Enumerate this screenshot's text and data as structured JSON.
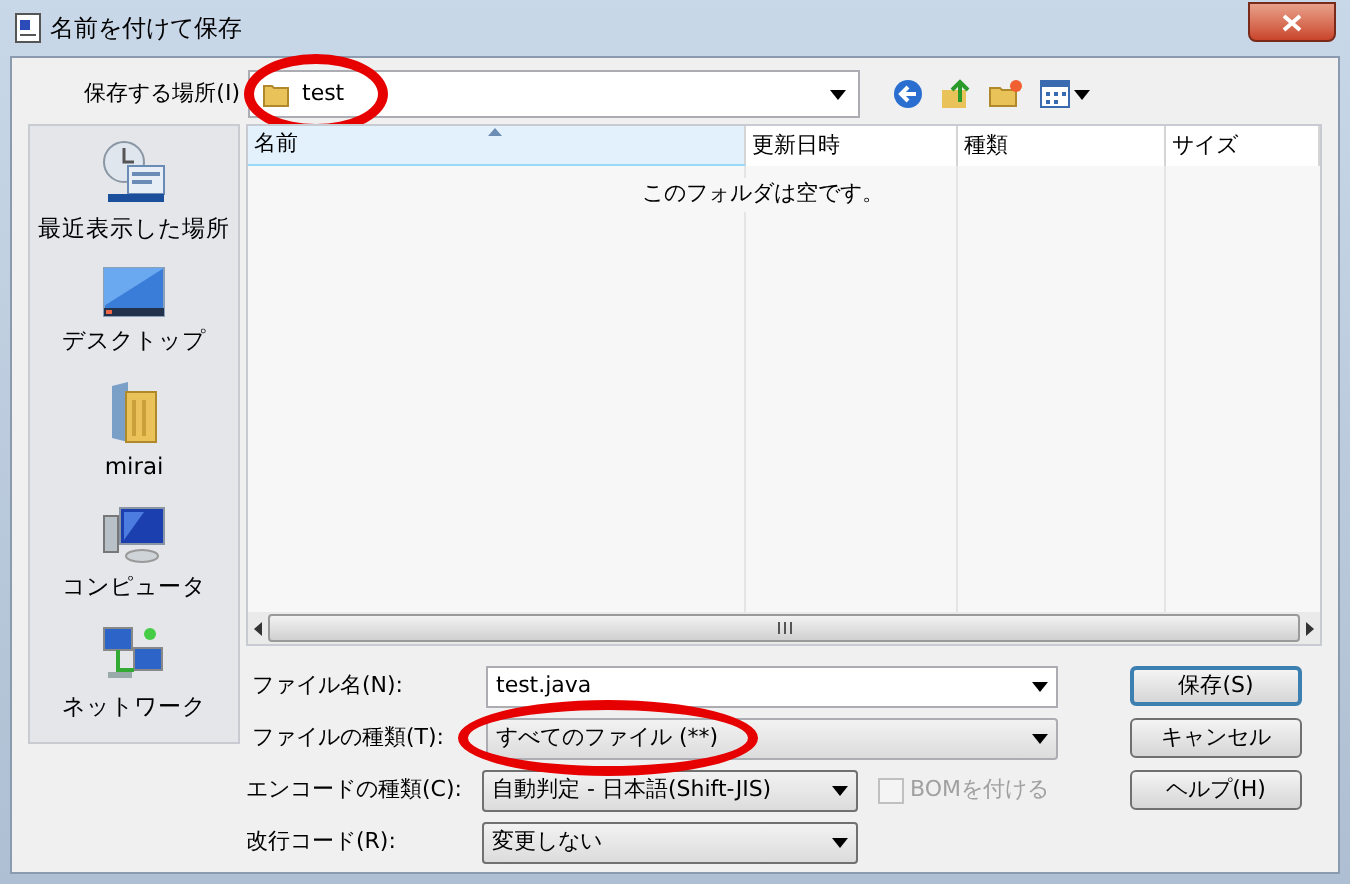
{
  "window": {
    "title": "名前を付けて保存"
  },
  "location": {
    "label": "保存する場所(I)",
    "value": "test",
    "highlighted": true
  },
  "places": [
    {
      "kind": "recent",
      "label": "最近表示した場所"
    },
    {
      "kind": "desktop",
      "label": "デスクトップ"
    },
    {
      "kind": "user",
      "label": "mirai"
    },
    {
      "kind": "computer",
      "label": "コンピュータ"
    },
    {
      "kind": "network",
      "label": "ネットワーク"
    }
  ],
  "file_list": {
    "columns": [
      {
        "label": "名前",
        "sorted": true
      },
      {
        "label": "更新日時",
        "sorted": false
      },
      {
        "label": "種類",
        "sorted": false
      },
      {
        "label": "サイズ",
        "sorted": false
      }
    ],
    "empty_message": "このフォルダは空です。"
  },
  "fields": [
    {
      "kind": "combo",
      "label": "ファイル名(N):",
      "value": "test.java",
      "highlighted": false
    },
    {
      "kind": "select",
      "label": "ファイルの種類(T):",
      "value": "すべてのファイル (**)",
      "highlighted": true
    }
  ],
  "encoding": {
    "label": "エンコードの種類(C):",
    "value": "自動判定 - 日本語(Shift-JIS)",
    "bom": {
      "label": "BOMを付ける",
      "checked": false,
      "disabled": true
    }
  },
  "line_ending": {
    "label": "改行コード(R):",
    "value": "変更しない"
  },
  "buttons": [
    {
      "label": "保存(S)",
      "default": true
    },
    {
      "label": "キャンセル",
      "default": false
    },
    {
      "label": "ヘルプ(H)",
      "default": false
    }
  ]
}
